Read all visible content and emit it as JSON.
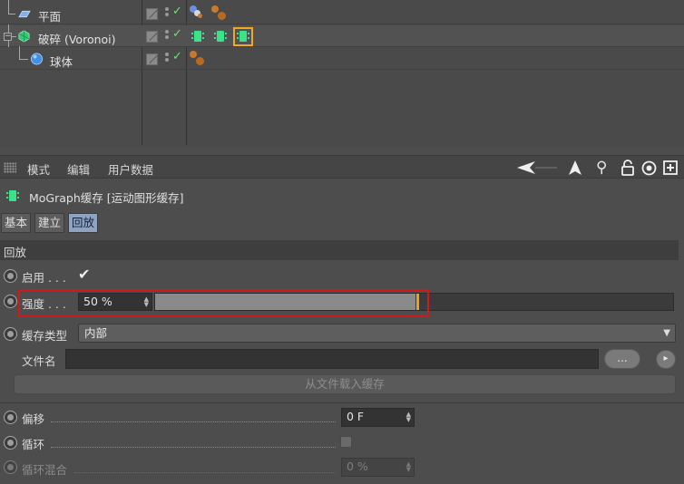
{
  "objects": [
    {
      "name": "平面"
    },
    {
      "name": "破碎 (Voronoi)"
    },
    {
      "name": "球体"
    }
  ],
  "toolbar": {
    "menus": [
      "模式",
      "编辑",
      "用户数据"
    ]
  },
  "attr": {
    "title": "MoGraph缓存 [运动图形缓存]",
    "tabs": [
      "基本",
      "建立",
      "回放"
    ],
    "active_tab": "回放",
    "section": "回放"
  },
  "params": {
    "enable": {
      "label": "启用 . . .",
      "checked": true,
      "mark": "✔"
    },
    "strength": {
      "label": "强度 . . .",
      "value": "50 %",
      "fraction": 0.5
    },
    "cache_type": {
      "label": "缓存类型",
      "value": "内部"
    },
    "filename": {
      "label": "文件名",
      "value": "",
      "browse": "...",
      "play": "▸"
    },
    "load_button": "从文件载入缓存",
    "offset": {
      "label": "偏移",
      "value": "0 F"
    },
    "loop": {
      "label": "循环",
      "checked": false
    },
    "loop_blend": {
      "label": "循环混合",
      "value": "0 %"
    }
  },
  "colors": {
    "accent_tab": "#8fa3c0",
    "slider_handle": "#f0a01e",
    "highlight": "#d0191b",
    "selected_tag": "#f5a623"
  }
}
